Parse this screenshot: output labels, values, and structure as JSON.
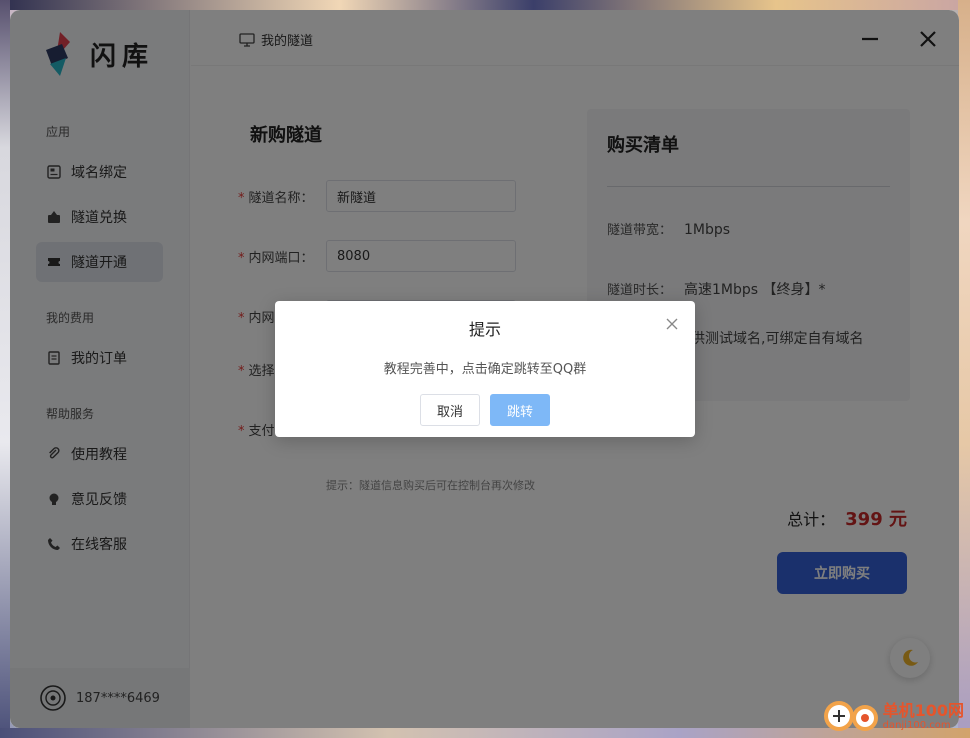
{
  "app": {
    "name": "闪库"
  },
  "topbar": {
    "title": "我的隧道"
  },
  "sidebar": {
    "sections": [
      {
        "label": "应用"
      },
      {
        "label": "我的费用"
      },
      {
        "label": "帮助服务"
      }
    ],
    "items": [
      {
        "label": "域名绑定",
        "icon": "domain-icon"
      },
      {
        "label": "隧道兑换",
        "icon": "exchange-icon"
      },
      {
        "label": "隧道开通",
        "icon": "ticket-icon",
        "active": true
      },
      {
        "label": "我的订单",
        "icon": "order-icon"
      },
      {
        "label": "使用教程",
        "icon": "paperclip-icon"
      },
      {
        "label": "意见反馈",
        "icon": "bulb-icon"
      },
      {
        "label": "在线客服",
        "icon": "phone-icon"
      }
    ],
    "user": {
      "phone": "187****6469"
    }
  },
  "form": {
    "title": "新购隧道",
    "fields": [
      {
        "label": "隧道名称：",
        "value": "新隧道"
      },
      {
        "label": "内网端口：",
        "value": "8080"
      },
      {
        "label": "内网"
      },
      {
        "label": "选择"
      },
      {
        "label": "支付"
      }
    ],
    "hint": "提示：隧道信息购买后可在控制台再次修改"
  },
  "cart": {
    "title": "购买清单",
    "bandwidth_label": "隧道带宽：",
    "bandwidth_value": "1Mbps",
    "duration_label": "隧道时长：",
    "duration_value": "高速1Mbps 【终身】*",
    "desc": "不限流量，提供测试域名,可绑定自有域名"
  },
  "summary": {
    "total_label": "总计：",
    "total_value": "399 元",
    "buy_label": "立即购买"
  },
  "dialog": {
    "title": "提示",
    "message": "教程完善中，点击确定跳转至QQ群",
    "cancel_label": "取消",
    "confirm_label": "跳转"
  },
  "watermark": {
    "main": "单机100网",
    "sub": "danji100.com"
  },
  "colors": {
    "accent": "#3561d8",
    "price": "#c62828",
    "dialog_confirm": "#7eb8f7",
    "required": "#e53935"
  }
}
